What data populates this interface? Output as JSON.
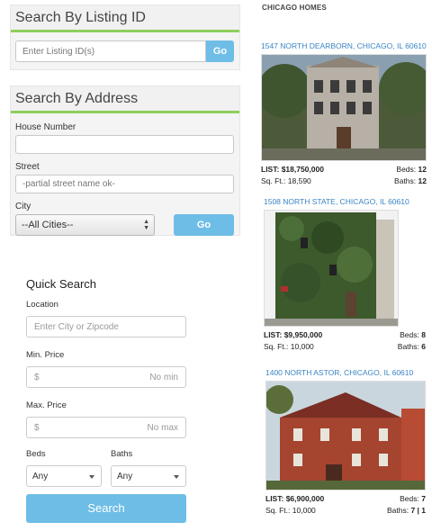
{
  "listing_id_search": {
    "title": "Search By Listing ID",
    "placeholder": "Enter Listing ID(s)",
    "go_label": "Go"
  },
  "address_search": {
    "title": "Search By Address",
    "house_number_label": "House Number",
    "house_number_value": "",
    "street_label": "Street",
    "street_placeholder": "-partial street name ok-",
    "city_label": "City",
    "city_value": "--All Cities--",
    "go_label": "Go"
  },
  "quick_search": {
    "title": "Quick Search",
    "location_label": "Location",
    "location_placeholder": "Enter City or Zipcode",
    "min_price_label": "Min. Price",
    "min_price_prefix": "$",
    "min_price_placeholder": "No min",
    "max_price_label": "Max. Price",
    "max_price_prefix": "$",
    "max_price_placeholder": "No max",
    "beds_label": "Beds",
    "beds_value": "Any",
    "baths_label": "Baths",
    "baths_value": "Any",
    "search_label": "Search"
  },
  "listings_section": {
    "title": "CHICAGO HOMES",
    "listings": [
      {
        "address": "1547 NORTH DEARBORN, CHICAGO, IL 60610",
        "list_label": "LIST:",
        "list_price": "$18,750,000",
        "beds_label": "Beds:",
        "beds": "12",
        "sqft_label": "Sq. Ft.:",
        "sqft": "18,590",
        "baths_label": "Baths:",
        "baths": "12"
      },
      {
        "address": "1508 NORTH STATE, CHICAGO, IL 60610",
        "list_label": "LIST:",
        "list_price": "$9,950,000",
        "beds_label": "Beds:",
        "beds": "8",
        "sqft_label": "Sq. Ft.:",
        "sqft": "10,000",
        "baths_label": "Baths:",
        "baths": "6"
      },
      {
        "address": "1400 NORTH ASTOR, CHICAGO, IL 60610",
        "list_label": "LIST:",
        "list_price": "$6,900,000",
        "beds_label": "Beds:",
        "beds": "7",
        "sqft_label": "Sq. Ft.:",
        "sqft": "10,000",
        "baths_label": "Baths:",
        "baths": "7 | 1"
      }
    ]
  },
  "colors": {
    "accent_green": "#8dcf5c",
    "button_blue": "#6ebde6",
    "link_blue": "#3a84c4"
  }
}
